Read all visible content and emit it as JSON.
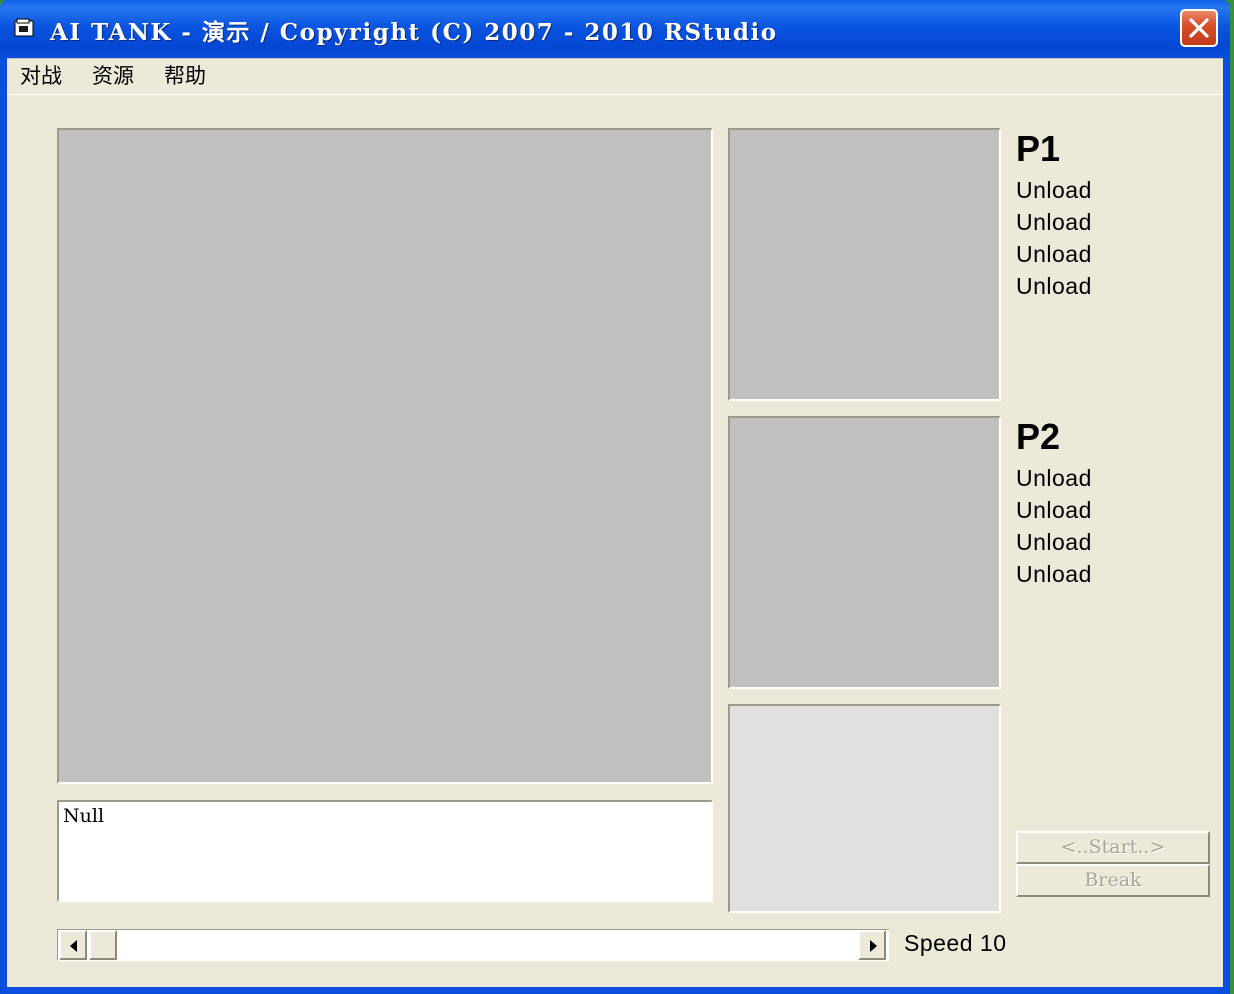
{
  "window": {
    "title": "AI TANK - 演示 / Copyright (C) 2007 - 2010 RStudio",
    "icon": "app-window-icon",
    "close_icon": "close-icon"
  },
  "menubar": {
    "items": [
      {
        "label": "对战"
      },
      {
        "label": "资源"
      },
      {
        "label": "帮助"
      }
    ]
  },
  "players": [
    {
      "name": "P1",
      "slots": [
        "Unload",
        "Unload",
        "Unload",
        "Unload"
      ]
    },
    {
      "name": "P2",
      "slots": [
        "Unload",
        "Unload",
        "Unload",
        "Unload"
      ]
    }
  ],
  "log": {
    "text": "Null"
  },
  "buttons": {
    "start_label": "<..Start..>",
    "break_label": "Break"
  },
  "speed": {
    "label": "Speed",
    "value": "10"
  },
  "colors": {
    "titlebar": "#0a55e0",
    "client_bg": "#ece9d8",
    "panel_gray": "#c0c0c0",
    "panel_light": "#e0e0e0",
    "disabled_text": "#a9a698"
  }
}
